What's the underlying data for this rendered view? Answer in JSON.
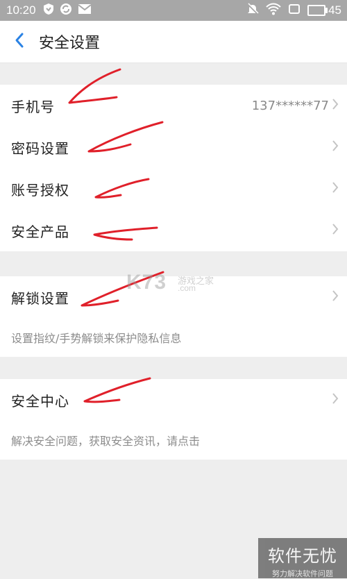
{
  "status_bar": {
    "time": "10:20",
    "battery": "45"
  },
  "header": {
    "title": "安全设置"
  },
  "group1": {
    "items": [
      {
        "label": "手机号",
        "value": "137******77"
      },
      {
        "label": "密码设置"
      },
      {
        "label": "账号授权"
      },
      {
        "label": "安全产品"
      }
    ]
  },
  "group2": {
    "label": "解锁设置",
    "description": "设置指纹/手势解锁来保护隐私信息"
  },
  "group3": {
    "label": "安全中心",
    "description": "解决安全问题，获取安全资讯，请点击"
  },
  "watermark": {
    "logo": "K73",
    "site_cn": "游戏之家",
    "site_en": ".com"
  },
  "brand": {
    "title": "软件无忧",
    "subtitle": "努力解决软件问题"
  },
  "colors": {
    "accent": "#2a82e4",
    "annotation": "#e0202a",
    "status_bar": "#a7a7a7"
  },
  "icons": [
    "shield-icon",
    "sync-icon",
    "mail-icon",
    "mute-icon",
    "wifi-icon",
    "screen-icon",
    "battery-icon",
    "back-chevron-icon",
    "chevron-right-icon"
  ]
}
